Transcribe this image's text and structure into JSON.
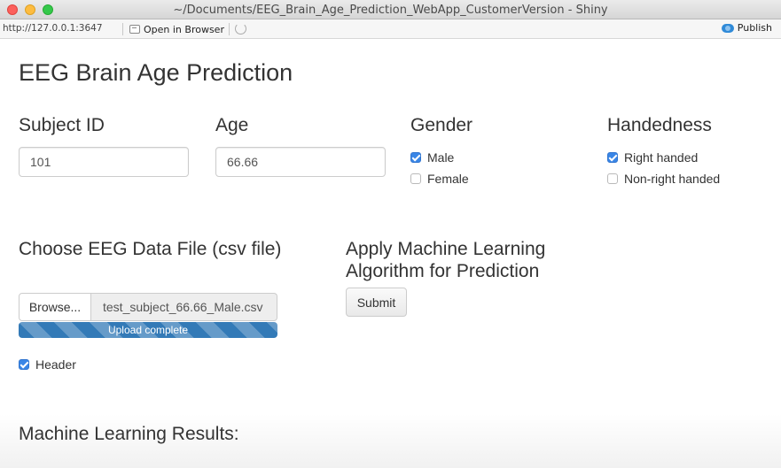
{
  "window": {
    "title": "~/Documents/EEG_Brain_Age_Prediction_WebApp_CustomerVersion - Shiny"
  },
  "toolbar": {
    "url": "http://127.0.0.1:3647",
    "open_in_browser_label": "Open in Browser",
    "publish_label": "Publish",
    "icons": [
      "open-in-browser-icon",
      "refresh-icon",
      "publish-icon"
    ]
  },
  "app": {
    "title": "EEG Brain Age Prediction",
    "subject_id": {
      "label": "Subject ID",
      "value": "101"
    },
    "age": {
      "label": "Age",
      "value": "66.66"
    },
    "gender": {
      "label": "Gender",
      "options": [
        {
          "label": "Male",
          "checked": true
        },
        {
          "label": "Female",
          "checked": false
        }
      ]
    },
    "handedness": {
      "label": "Handedness",
      "options": [
        {
          "label": "Right handed",
          "checked": true
        },
        {
          "label": "Non-right handed",
          "checked": false
        }
      ]
    },
    "file_upload": {
      "title": "Choose EEG Data File (csv file)",
      "browse_label": "Browse...",
      "file_name": "test_subject_66.66_Male.csv",
      "progress_label": "Upload complete",
      "progress_fraction": 1.0
    },
    "header_checkbox": {
      "label": "Header",
      "checked": true
    },
    "submit_section": {
      "title": "Apply Machine Learning Algorithm for Prediction",
      "submit_label": "Submit"
    },
    "results": {
      "title": "Machine Learning Results:"
    }
  },
  "colors": {
    "accent": "#337ab7",
    "checkbox": "#3a86e6",
    "text": "#333333"
  }
}
